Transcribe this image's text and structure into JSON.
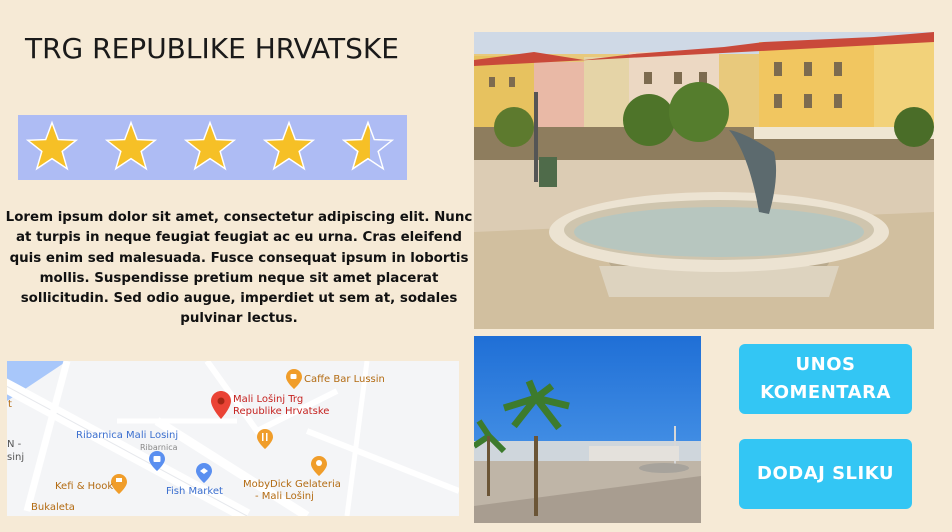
{
  "place": {
    "title": "TRG REPUBLIKE HRVATSKE",
    "rating": 4.5,
    "rating_max": 5,
    "description": "Lorem ipsum dolor sit amet, consectetur adipiscing elit. Nunc at turpis in neque feugiat feugiat ac eu urna. Cras eleifend quis enim sed malesuada. Fusce consequat ipsum in lobortis mollis. Suspendisse pretium neque sit amet placerat sollicitudin. Sed odio augue, imperdiet ut sem at, sodales pulvinar lectus."
  },
  "map": {
    "labels": {
      "cafe": "Caffe Bar Lussin",
      "pin_line1": "Mali Lošinj Trg",
      "pin_line2": "Republike Hrvatske",
      "ribarnica": "Ribarnica Mali Losinj",
      "ribarnica_sub": "Ribarnica",
      "kefi": "Kefi & Hook",
      "fish_market": "Fish Market",
      "moby_line1": "MobyDick Gelateria",
      "moby_line2": "- Mali Lošinj",
      "bukaleta": "Bukaleta",
      "edge_n": "N -",
      "edge_sinj": "sinj",
      "edge_t": "t"
    },
    "colors": {
      "water": "#a8c7fa",
      "road": "#ffffff",
      "pin_red": "#ea4335",
      "poi_orange": "#f09d2a",
      "poi_blue": "#5a8ff0",
      "poi_text_orange": "#b36b12",
      "poi_text_blue": "#3b6fcf"
    }
  },
  "buttons": {
    "comment_line1": "UNOS",
    "comment_line2": "KOMENTARA",
    "add_photo": "DODAJ SLIKU"
  },
  "colors": {
    "background": "#f6ead6",
    "star_panel": "#aebcf4",
    "star_fill": "#f6c026",
    "button": "#33c6f4"
  },
  "icons": [
    "star-icon",
    "map-pin-icon",
    "cafe-icon",
    "restaurant-icon",
    "shopping-icon",
    "ice-cream-icon",
    "fish-icon"
  ]
}
